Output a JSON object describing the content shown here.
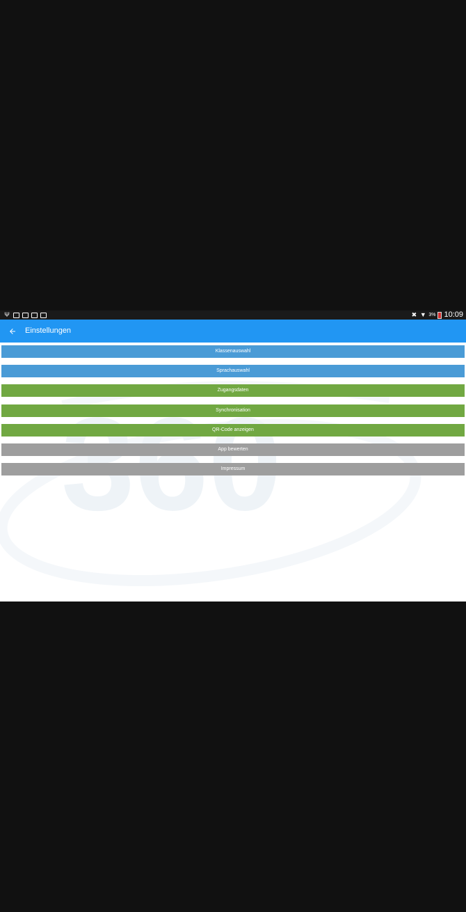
{
  "status_bar": {
    "battery_percent": "3%",
    "clock": "10:09"
  },
  "app_bar": {
    "title": "Einstellungen",
    "back_icon": "arrow-left-icon"
  },
  "colors": {
    "app_bar": "#2196f3",
    "button_blue": "#4a9bd6",
    "button_green": "#71a842",
    "button_gray": "#9e9e9e"
  },
  "menu": [
    {
      "label": "Klassenauswahl",
      "color": "blue"
    },
    {
      "label": "Sprachauswahl",
      "color": "blue"
    },
    {
      "label": "Zugangsdaten",
      "color": "green"
    },
    {
      "label": "Synchronisation",
      "color": "green"
    },
    {
      "label": "QR-Code anzeigen",
      "color": "green"
    },
    {
      "label": "App bewerten",
      "color": "gray"
    },
    {
      "label": "Impressum",
      "color": "gray"
    }
  ],
  "watermark": {
    "text": "360"
  }
}
